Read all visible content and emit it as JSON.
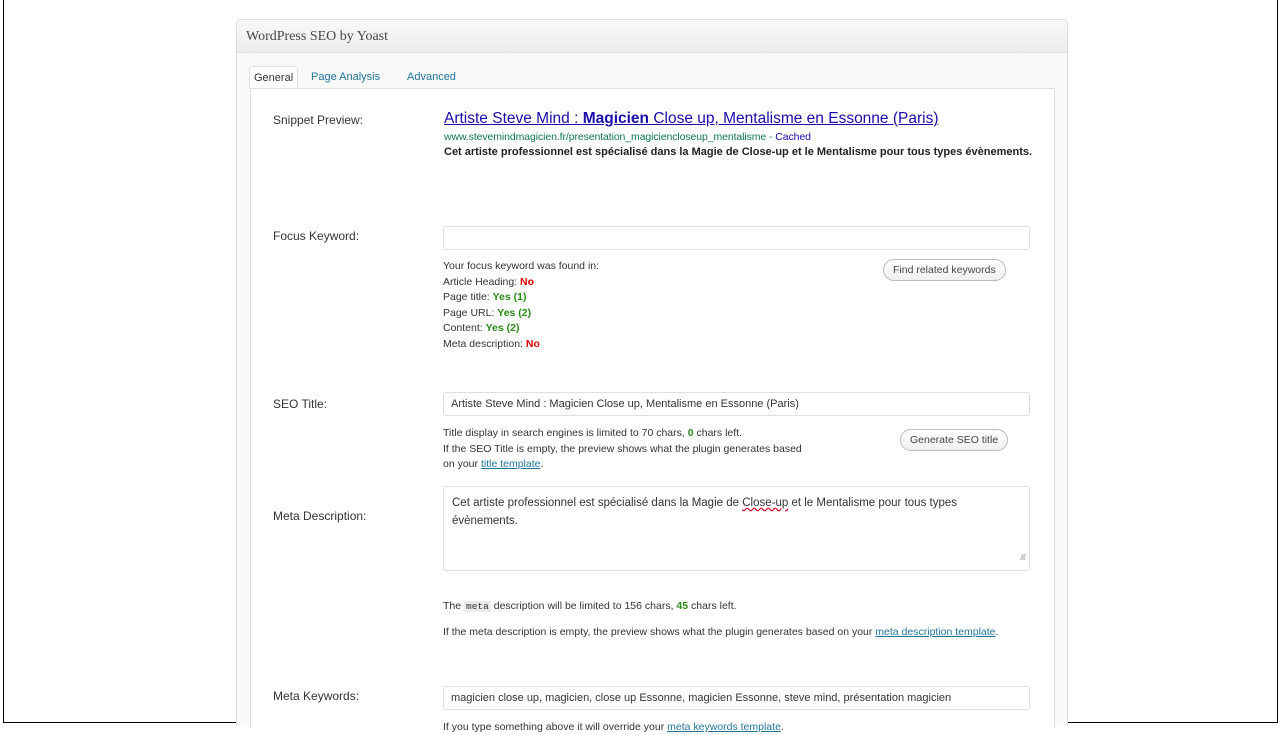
{
  "metabox": {
    "title": "WordPress SEO by Yoast"
  },
  "tabs": [
    {
      "label": "General",
      "active": true
    },
    {
      "label": "Page Analysis",
      "active": false
    },
    {
      "label": "Advanced",
      "active": false
    }
  ],
  "snippet": {
    "label": "Snippet Preview:",
    "title_start": "Artiste Steve Mind : ",
    "title_bold": "Magicien",
    "title_end": " Close up, Mentalisme en Essonne (Paris)",
    "url": "www.stevemindmagicien.fr/presentation_magiciencloseup_mentalisme",
    "url_sep": " - ",
    "cached": "Cached",
    "description": "Cet artiste professionnel est spécialisé dans la Magie de Close-up et le Mentalisme pour tous types évènements."
  },
  "focus_keyword": {
    "label": "Focus Keyword:",
    "value": "",
    "button": "Find related keywords",
    "found_intro": "Your focus keyword was found in:",
    "results": [
      {
        "label": "Article Heading: ",
        "value": "No",
        "status": "no"
      },
      {
        "label": "Page title: ",
        "value": "Yes (1)",
        "status": "yes"
      },
      {
        "label": "Page URL: ",
        "value": "Yes (2)",
        "status": "yes"
      },
      {
        "label": "Content: ",
        "value": "Yes (2)",
        "status": "yes"
      },
      {
        "label": "Meta description: ",
        "value": "No",
        "status": "no"
      }
    ]
  },
  "seo_title": {
    "label": "SEO Title:",
    "value": "Artiste Steve Mind : Magicien Close up, Mentalisme en Essonne (Paris)",
    "button": "Generate SEO title",
    "help_1a": "Title display in search engines is limited to 70 chars, ",
    "chars_left": "0",
    "help_1b": " chars left.",
    "help_2": "If the SEO Title is empty, the preview shows what the plugin generates based",
    "help_3a": "on your ",
    "help_link": "title template",
    "help_3b": "."
  },
  "meta_description": {
    "label": "Meta Description:",
    "value_a": "Cet artiste professionnel est spécialisé dans la Magie de ",
    "value_spell": "Close-up",
    "value_b": " et le Mentalisme pour tous types évènements.",
    "help_1a": "The ",
    "code": "meta",
    "help_1b": " description will be limited to 156 chars, ",
    "chars_left": "45",
    "help_1c": " chars left.",
    "help_2": "If the meta description is empty, the preview shows what the plugin generates based on your ",
    "help_link": "meta description template",
    "help_2b": "."
  },
  "meta_keywords": {
    "label": "Meta Keywords:",
    "value": "magicien close up, magicien, close up Essonne, magicien Essonne, steve mind, présentation magicien",
    "help_a": "If you type something above it will override your ",
    "help_link": "meta keywords template",
    "help_b": "."
  }
}
